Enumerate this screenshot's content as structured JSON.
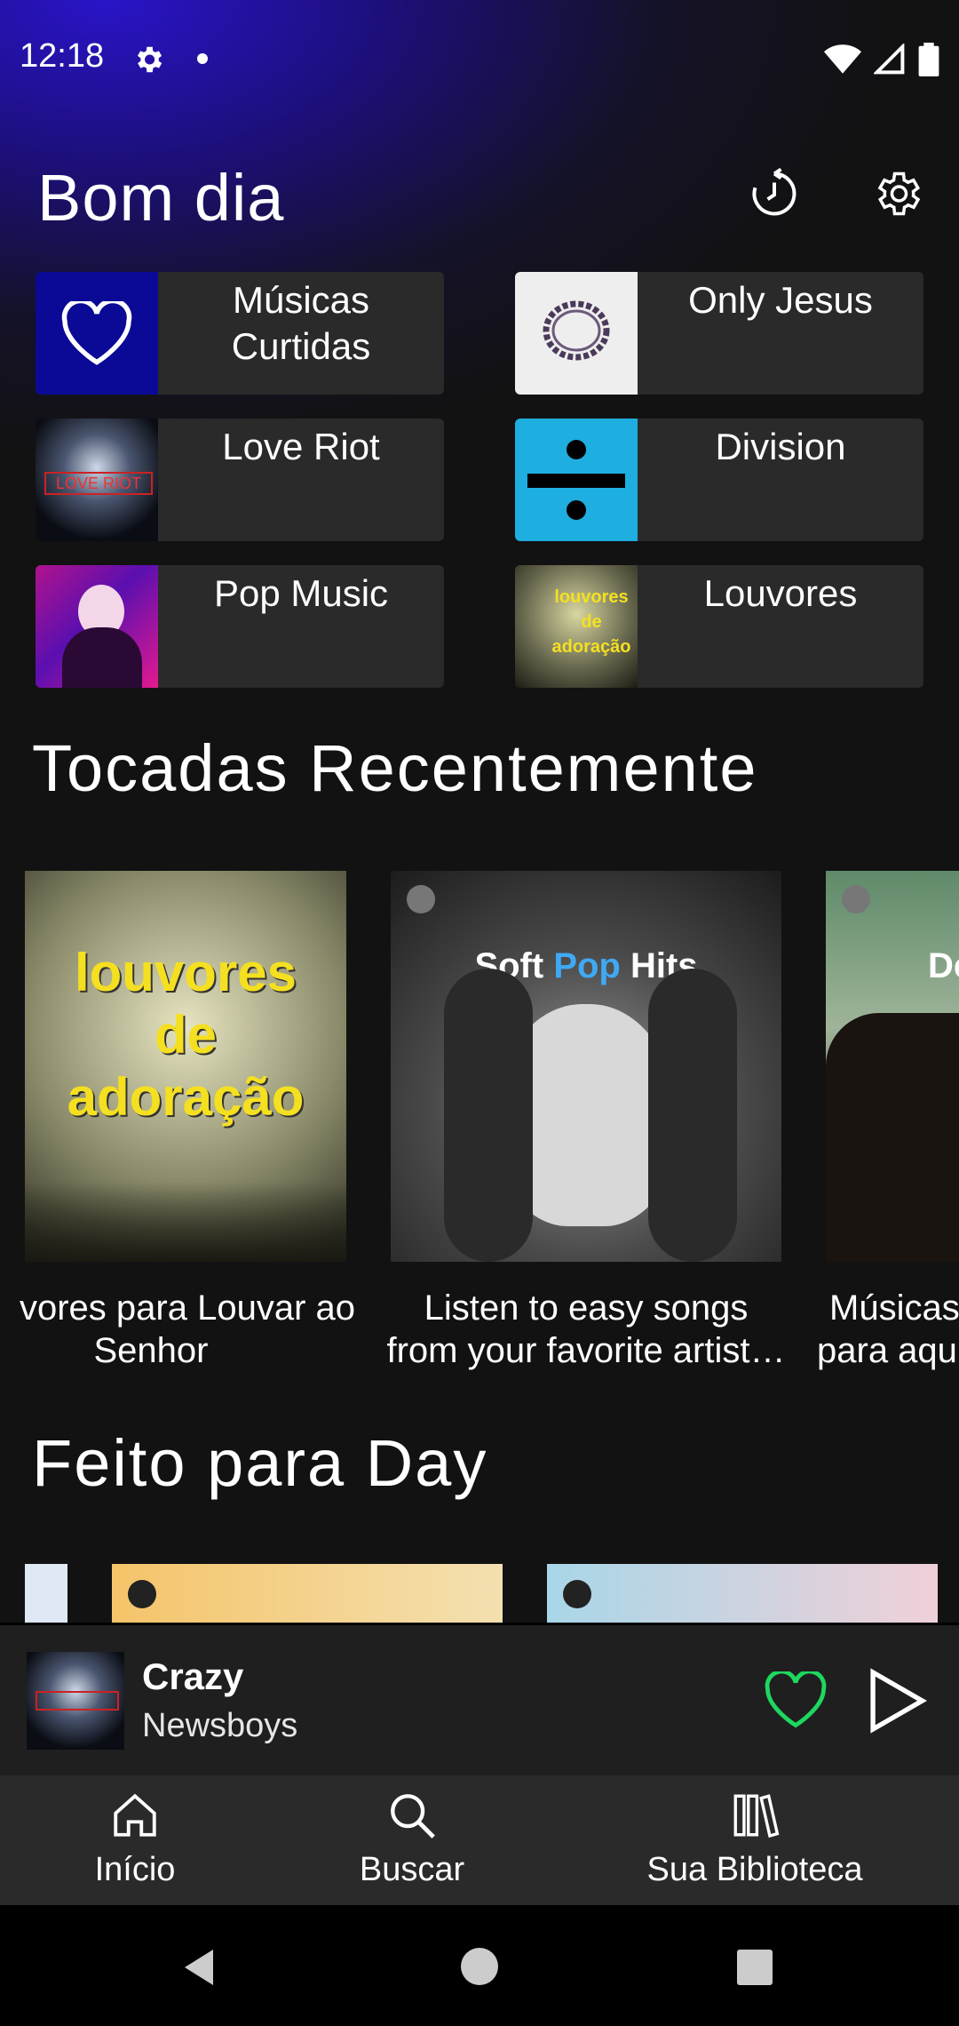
{
  "status_bar": {
    "time": "12:18"
  },
  "header": {
    "greeting": "Bom dia"
  },
  "quick_access": [
    {
      "label": "Músicas\nCurtidas",
      "art": "liked-songs"
    },
    {
      "label": "Only Jesus",
      "art": "crown-of-thorns"
    },
    {
      "label": "Love Riot",
      "art": "love-riot"
    },
    {
      "label": "Division",
      "art": "divide"
    },
    {
      "label": "Pop Music",
      "art": "pop-music"
    },
    {
      "label": "Louvores",
      "art": "louvores"
    }
  ],
  "recent": {
    "title": "Tocadas Recentemente",
    "items": [
      {
        "caption_line1": "vores para Louvar ao",
        "caption_line2": "Senhor",
        "art_text": [
          "louvores",
          "de",
          "adoração"
        ]
      },
      {
        "caption_line1": "Listen to easy songs",
        "caption_line2": "from your favorite artist…",
        "art_text_a": "Soft ",
        "art_text_b": "Pop",
        "art_text_c": " Hits"
      },
      {
        "caption_line1": "Músicas",
        "caption_line2": "para aqu",
        "art_text": "De"
      }
    ]
  },
  "made_for": {
    "title": "Feito para Day"
  },
  "now_playing": {
    "title": "Crazy",
    "artist": "Newsboys"
  },
  "nav": {
    "home": "Início",
    "search": "Buscar",
    "library": "Sua Biblioteca"
  },
  "colors": {
    "accent_green": "#1ed760",
    "background": "#121212",
    "card": "#2a2a2a"
  }
}
